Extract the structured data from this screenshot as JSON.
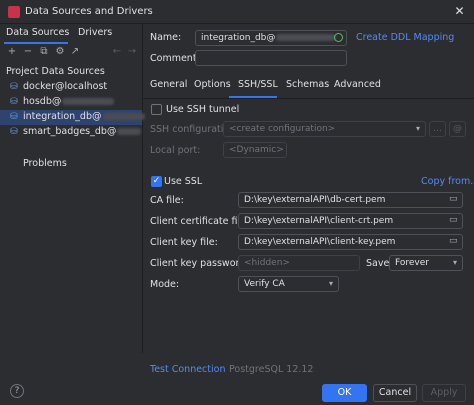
{
  "window": {
    "title": "Data Sources and Drivers",
    "close_glyph": "✕"
  },
  "left_panel": {
    "tabs": [
      {
        "label": "Data Sources",
        "active": true
      },
      {
        "label": "Drivers",
        "active": false
      }
    ],
    "toolbar_icons": [
      "add-icon",
      "remove-icon",
      "duplicate-icon",
      "settings-icon",
      "export-icon"
    ],
    "toolbar_glyphs": [
      "+",
      "−",
      "⧉",
      "⚙",
      "↗"
    ],
    "nav_glyphs": [
      "←",
      "→"
    ],
    "section_title": "Project Data Sources",
    "items": [
      {
        "label": "docker@localhost",
        "selected": false,
        "blurred": false
      },
      {
        "label": "hosdb@",
        "selected": false,
        "blurred": true
      },
      {
        "label": "integration_db@",
        "selected": true,
        "blurred": true
      },
      {
        "label": "smart_badges_db@",
        "selected": false,
        "blurred": true
      }
    ],
    "problems_label": "Problems"
  },
  "form": {
    "name_label": "Name:",
    "name_value": "integration_db@",
    "comment_label": "Comment:",
    "comment_value": "",
    "create_ddl_link": "Create DDL Mapping"
  },
  "subtabs": [
    {
      "label": "General",
      "active": false
    },
    {
      "label": "Options",
      "active": false
    },
    {
      "label": "SSH/SSL",
      "active": true
    },
    {
      "label": "Schemas",
      "active": false
    },
    {
      "label": "Advanced",
      "active": false
    }
  ],
  "ssh": {
    "use_ssh_label": "Use SSH tunnel",
    "use_ssh_checked": false,
    "config_label": "SSH configuration:",
    "config_value": "<create configuration>",
    "local_port_label": "Local port:",
    "local_port_value": "<Dynamic>"
  },
  "ssl": {
    "use_ssl_label": "Use SSL",
    "use_ssl_checked": true,
    "copy_from_link": "Copy from...",
    "ca_file_label": "CA file:",
    "ca_file_value": "D:\\key\\externalAPI\\db-cert.pem",
    "client_cert_label": "Client certificate file:",
    "client_cert_value": "D:\\key\\externalAPI\\client-crt.pem",
    "client_key_label": "Client key file:",
    "client_key_value": "D:\\key\\externalAPI\\client-key.pem",
    "client_key_password_label": "Client key password:",
    "client_key_password_placeholder": "<hidden>",
    "save_label": "Save:",
    "save_value": "Forever",
    "mode_label": "Mode:",
    "mode_value": "Verify CA"
  },
  "footer": {
    "test_connection": "Test Connection",
    "db_version": "PostgreSQL 12.12",
    "ok": "OK",
    "cancel": "Cancel",
    "apply": "Apply",
    "help": "?"
  },
  "colors": {
    "accent": "#3574f0",
    "link": "#548af7",
    "selection": "#2e436e",
    "background": "#2b2d30"
  }
}
